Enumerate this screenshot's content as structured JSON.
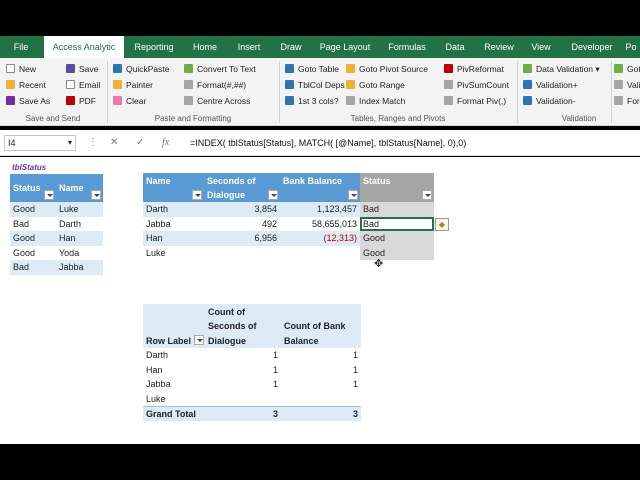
{
  "ribbon": {
    "tabs": [
      "File",
      "Access Analytic",
      "Reporting",
      "Home",
      "Insert",
      "Draw",
      "Page Layout",
      "Formulas",
      "Data",
      "Review",
      "View",
      "Developer",
      "Po"
    ],
    "active_tab": "Access Analytic",
    "buttons": {
      "new": "New",
      "recent": "Recent",
      "save_as": "Save As",
      "save": "Save",
      "email": "Email",
      "pdf": "PDF",
      "quickpaste": "QuickPaste",
      "painter": "Painter",
      "clear": "Clear",
      "convert_to_text": "Convert To Text",
      "format": "Format(#,##)",
      "centre_across": "Centre Across",
      "goto_table": "Goto Table",
      "tblcol_deps": "TblCol Deps",
      "first_cols": "1st 3 cols?",
      "goto_pivot_source": "Goto Pivot Source",
      "goto_range": "Goto Range",
      "index_match": "Index Match",
      "pivreformat": "PivReformat",
      "pivsumcount": "PivSumCount",
      "format_piv": "Format Piv(,)",
      "data_validation": "Data Validation",
      "validation_plus": "Validation+",
      "validation_minus": "Validation-",
      "goto_cut": "Goto",
      "valid_cut": "Valid",
      "form_cut": "Form"
    },
    "groups": {
      "save_send": "Save and Send",
      "paste_formatting": "Paste and Formatting",
      "tables_ranges_pivots": "Tables, Ranges and Pivots",
      "validation": "Validation"
    }
  },
  "formula_bar": {
    "cell_ref": "I4",
    "cancel_icon": "✕",
    "enter_icon": "✓",
    "fx_label": "fx",
    "formula": "=INDEX( tblStatus[Status], MATCH( [@Name],  tblStatus[Name], 0),0)"
  },
  "status_table": {
    "caption": "tblStatus",
    "headers": [
      "Status",
      "Name"
    ],
    "rows": [
      [
        "Good",
        "Luke"
      ],
      [
        "Bad",
        "Darth"
      ],
      [
        "Good",
        "Han"
      ],
      [
        "Good",
        "Yoda"
      ],
      [
        "Bad",
        "Jabba"
      ]
    ]
  },
  "main_table": {
    "headers": [
      "Name",
      "Seconds of Dialogue",
      "Bank Balance",
      "Status"
    ],
    "rows": [
      [
        "Darth",
        "3,854",
        "1,123,457",
        "Bad"
      ],
      [
        "Jabba",
        "492",
        "58,655,013",
        "Bad"
      ],
      [
        "Han",
        "6,956",
        "(12,313)",
        "Good"
      ],
      [
        "Luke",
        "",
        "",
        "Good"
      ]
    ]
  },
  "pivot": {
    "row_label": "Row Label",
    "col1_header": "Count of Seconds of Dialogue",
    "col2_header": "Count of Bank Balance",
    "rows": [
      [
        "Darth",
        "1",
        "1"
      ],
      [
        "Han",
        "1",
        "1"
      ],
      [
        "Jabba",
        "1",
        "1"
      ],
      [
        "Luke",
        "",
        ""
      ]
    ],
    "total": [
      "Grand Total",
      "3",
      "3"
    ]
  },
  "colors": {
    "excel_green": "#217346",
    "table_header": "#5b9bd5",
    "band": "#ddebf7",
    "negative": "#c00000"
  }
}
